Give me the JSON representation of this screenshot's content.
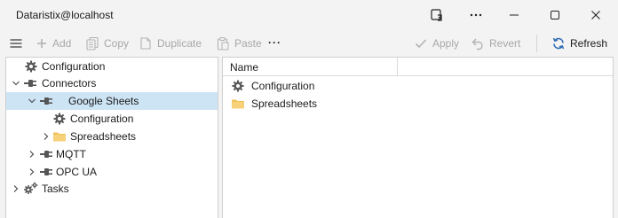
{
  "window": {
    "title": "Dataristix@localhost"
  },
  "toolbar": {
    "add": "Add",
    "copy": "Copy",
    "duplicate": "Duplicate",
    "paste": "Paste",
    "more": "···",
    "apply": "Apply",
    "revert": "Revert",
    "refresh": "Refresh"
  },
  "tree": {
    "items": [
      {
        "label": "Configuration",
        "icon": "gear-icon",
        "level": 0,
        "expander": "none"
      },
      {
        "label": "Connectors",
        "icon": "plug-icon",
        "level": 0,
        "expander": "expanded"
      },
      {
        "label": "Google Sheets",
        "icon": "plug-icon",
        "level": 1,
        "expander": "expanded",
        "selected": true
      },
      {
        "label": "Configuration",
        "icon": "gear-icon",
        "level": 2,
        "expander": "none"
      },
      {
        "label": "Spreadsheets",
        "icon": "folder-icon",
        "level": 2,
        "expander": "collapsed"
      },
      {
        "label": "MQTT",
        "icon": "plug-icon",
        "level": 1,
        "expander": "collapsed"
      },
      {
        "label": "OPC UA",
        "icon": "plug-icon",
        "level": 1,
        "expander": "collapsed"
      },
      {
        "label": "Tasks",
        "icon": "gears-icon",
        "level": 0,
        "expander": "collapsed"
      }
    ]
  },
  "list": {
    "column_name": "Name",
    "items": [
      {
        "label": "Configuration",
        "icon": "gear-icon"
      },
      {
        "label": "Spreadsheets",
        "icon": "folder-icon"
      }
    ]
  },
  "colors": {
    "selection": "#cde4f5",
    "folder": "#f2c25c",
    "refresh_accent": "#2f6db5",
    "disabled_text": "#a8a8a8"
  }
}
